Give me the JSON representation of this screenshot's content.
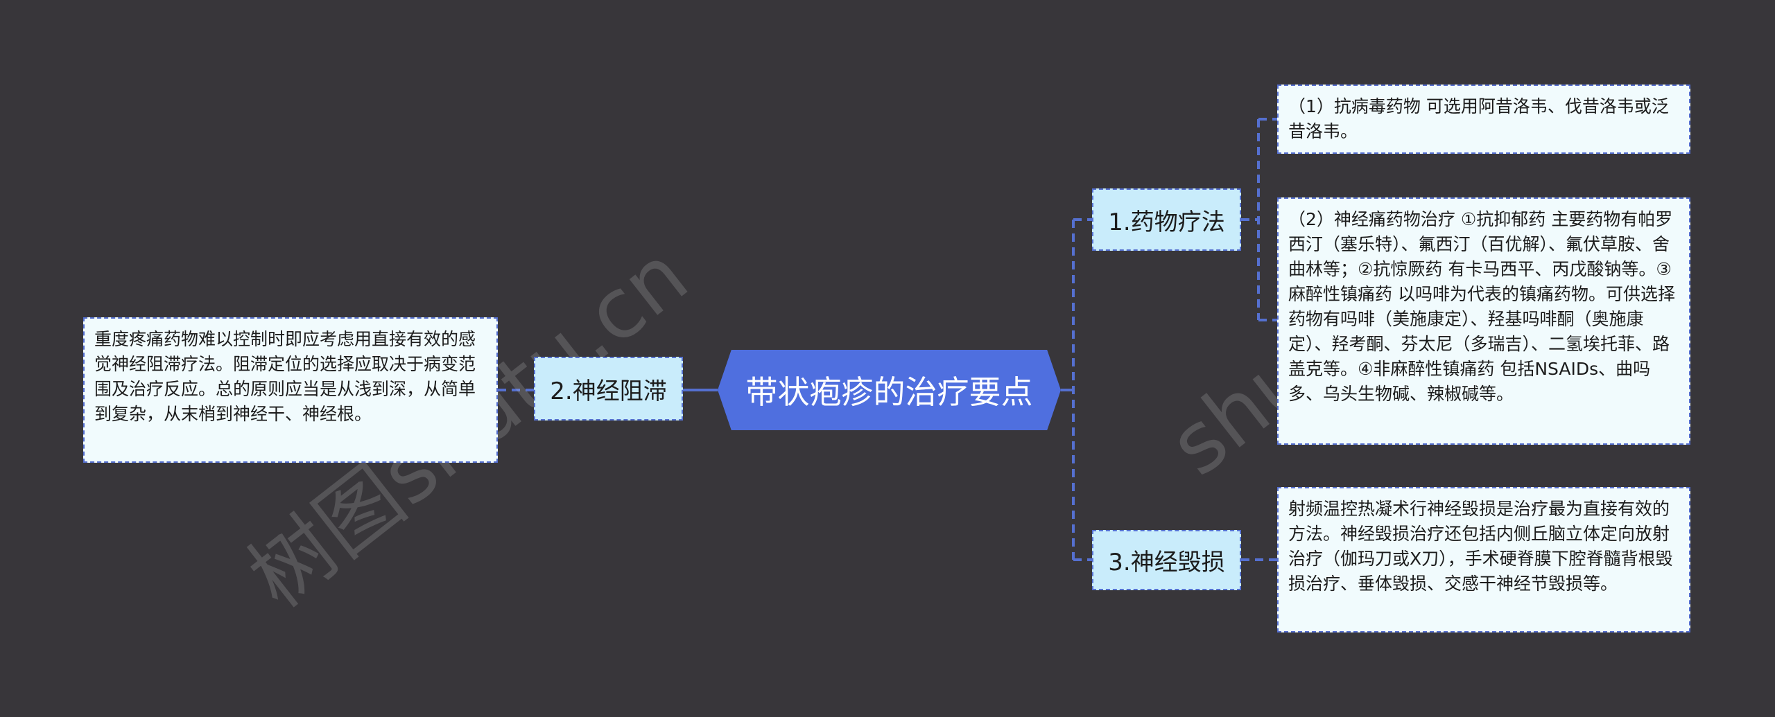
{
  "root": {
    "title": "带状疱疹的治疗要点"
  },
  "branches": [
    {
      "label": "1.药物疗法",
      "children": [
        "（1）抗病毒药物 可选用阿昔洛韦、伐昔洛韦或泛昔洛韦。",
        "（2）神经痛药物治疗 ①抗抑郁药 主要药物有帕罗西汀（塞乐特）、氟西汀（百优解）、氟伏草胺、舍曲林等；②抗惊厥药 有卡马西平、丙戊酸钠等。③麻醉性镇痛药 以吗啡为代表的镇痛药物。可供选择药物有吗啡（美施康定）、羟基吗啡酮（奥施康定）、羟考酮、芬太尼（多瑞吉）、二氢埃托菲、路盖克等。④非麻醉性镇痛药 包括NSAIDs、曲吗多、乌头生物碱、辣椒碱等。"
      ]
    },
    {
      "label": "2.神经阻滞",
      "children": [
        "重度疼痛药物难以控制时即应考虑用直接有效的感觉神经阻滞疗法。阻滞定位的选择应取决于病变范围及治疗反应。总的原则应当是从浅到深，从简单到复杂，从末梢到神经干、神经根。"
      ]
    },
    {
      "label": "3.神经毁损",
      "children": [
        "射频温控热凝术行神经毁损是治疗最为直接有效的方法。神经毁损治疗还包括内侧丘脑立体定向放射治疗（伽玛刀或X刀），手术硬脊膜下腔脊髓背根毁损治疗、垂体毁损、交感干神经节毁损等。"
      ]
    }
  ],
  "watermarks": [
    "树图shutu.cn",
    "shutu.cn"
  ],
  "colors": {
    "background": "#38363a",
    "root_fill": "#4f6fdf",
    "branch_fill": "#c9ecfb",
    "leaf_fill": "#f1fbfd",
    "connector": "#5570d0"
  }
}
